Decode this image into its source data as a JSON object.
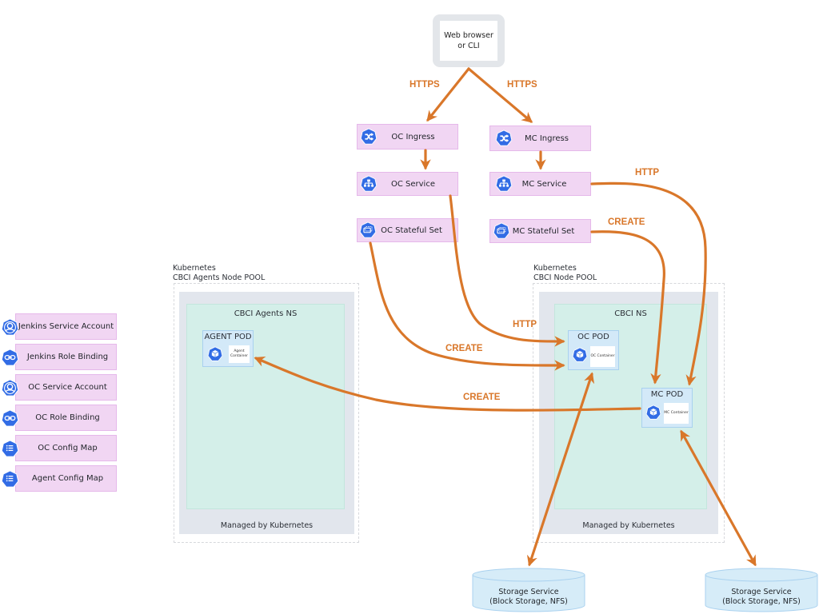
{
  "client": {
    "label": "Web browser\nor CLI"
  },
  "edge_labels": {
    "https_left": "HTTPS",
    "https_right": "HTTPS",
    "http_mc_service": "HTTP",
    "create_mc_statefulset": "CREATE",
    "http_oc_pod": "HTTP",
    "create_oc_pod": "CREATE",
    "create_agent_pod": "CREATE"
  },
  "oc": {
    "ingress": "OC Ingress",
    "service": "OC Service",
    "stateful_set": "OC Stateful Set"
  },
  "mc": {
    "ingress": "MC Ingress",
    "service": "MC Service",
    "stateful_set": "MC Stateful Set"
  },
  "legend": [
    {
      "label": "Jenkins Service Account",
      "icon": "service-account-icon",
      "badge": "sa"
    },
    {
      "label": "Jenkins Role Binding",
      "icon": "role-binding-icon",
      "badge": "rb"
    },
    {
      "label": "OC Service Account",
      "icon": "service-account-icon",
      "badge": "sa"
    },
    {
      "label": "OC Role Binding",
      "icon": "role-binding-icon",
      "badge": "rb"
    },
    {
      "label": "OC Config Map",
      "icon": "config-map-icon",
      "badge": "cm"
    },
    {
      "label": "Agent Config Map",
      "icon": "config-map-icon",
      "badge": "cm"
    }
  ],
  "agents_pool": {
    "title": "Kubernetes\nCBCI Agents Node POOL",
    "namespace": "CBCI Agents NS",
    "managed": "Managed by Kubernetes",
    "pod": {
      "title": "AGENT POD",
      "icon_badge": "pod",
      "container": "Agent\nContainer"
    }
  },
  "cbci_pool": {
    "title": "Kubernetes\nCBCI Node POOL",
    "namespace": "CBCI  NS",
    "managed": "Managed by Kubernetes",
    "oc_pod": {
      "title": "OC POD",
      "icon_badge": "pod",
      "container": "OC Container"
    },
    "mc_pod": {
      "title": "MC POD",
      "icon_badge": "pod",
      "container": "MC Container"
    }
  },
  "storage": [
    {
      "label": "Storage Service\n(Block Storage, NFS)"
    },
    {
      "label": "Storage Service\n(Block Storage, NFS)"
    }
  ],
  "colors": {
    "arrow": "#d9772a",
    "k8s_blue": "#326ce5",
    "resource_fill": "#f1d6f3",
    "namespace_fill": "#d4efe9",
    "pod_fill": "#d3e9f8",
    "storage_fill": "#d6ecf8"
  }
}
